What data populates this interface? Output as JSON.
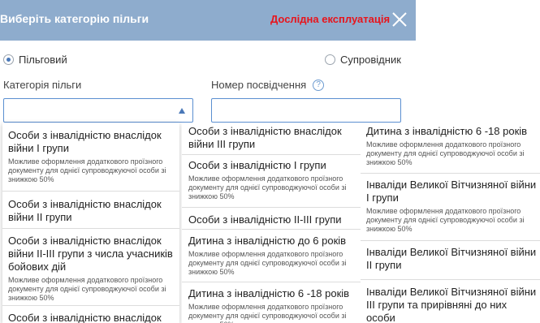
{
  "modal": {
    "title": "Виберіть категорію пільги",
    "badge": "Дослідна експлуатація",
    "badge_color": "#e8141b",
    "header_color": "#8eaccd",
    "close_icon": "close-icon"
  },
  "radios": [
    {
      "label": "Пільговий",
      "selected": true
    },
    {
      "label": "Супровідник",
      "selected": false
    }
  ],
  "fields": {
    "category_label": "Категорія пільги",
    "category_value": "",
    "certificate_label": "Номер посвідчення",
    "certificate_value": "",
    "help_icon": "help-icon"
  },
  "note": "Можливе оформлення додаткового проїзного документу для однієї супроводжуючої особи зі знижкою 50%",
  "columns": [
    [
      {
        "title": "Особи з інвалідністю внаслідок війни І групи",
        "note": true
      },
      {
        "title": "Особи з інвалідністю внаслідок війни ІІ групи",
        "note": false
      },
      {
        "title": "Особи з інвалідністю внаслідок війни ІІ-ІІІ групи з числа учасників бойових дій",
        "note": true
      },
      {
        "title": "Особи з інвалідністю внаслідок",
        "note": false
      }
    ],
    [
      {
        "title": "Особи з інвалідністю внаслідок війни ІІІ групи",
        "note": false
      },
      {
        "title": "Особи з інвалідністю І групи",
        "note": true
      },
      {
        "title": "Особи з інвалідністю ІІ-ІІІ групи",
        "note": false
      },
      {
        "title": "Дитина з інвалідністю до 6 років",
        "note": true
      },
      {
        "title": "Дитина з інвалідністю 6 -18 років",
        "note": true
      }
    ],
    [
      {
        "title": "Дитина з інвалідністю 6 -18 років",
        "note": true
      },
      {
        "title": "Інваліди Великої Вітчизняної війни І групи",
        "note": true
      },
      {
        "title": "Інваліди Великої Вітчизняної війни ІІ групи",
        "note": false
      },
      {
        "title": "Інваліди Великої Вітчизняної війни ІІІ групи та прирівняні до них особи",
        "note": false
      }
    ]
  ]
}
